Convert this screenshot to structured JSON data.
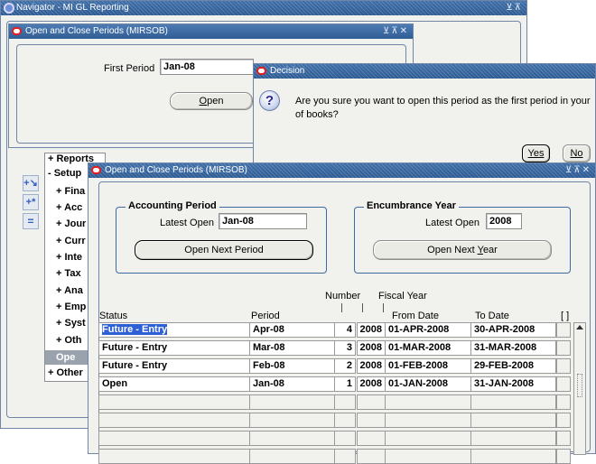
{
  "navigator": {
    "title": "Navigator - MI GL Reporting",
    "controls": "⊻⊼"
  },
  "first_window": {
    "title": "Open and Close Periods (MIRSOB)",
    "controls": "⊻⊼✕",
    "first_period_label": "First Period",
    "first_period_value": "Jan-08",
    "open_button": "Open",
    "open_button_mnemonic": "O"
  },
  "tree": {
    "items": [
      {
        "label": "+ Reports",
        "level": 0
      },
      {
        "label": "- Setup",
        "level": 0
      },
      {
        "label": "+ Fina",
        "level": 1
      },
      {
        "label": "+ Acc",
        "level": 1
      },
      {
        "label": "+ Jour",
        "level": 1
      },
      {
        "label": "+ Curr",
        "level": 1
      },
      {
        "label": "+ Inte",
        "level": 1
      },
      {
        "label": "+ Tax",
        "level": 1
      },
      {
        "label": "+ Ana",
        "level": 1
      },
      {
        "label": "+ Emp",
        "level": 1
      },
      {
        "label": "+ Syst",
        "level": 1
      },
      {
        "label": "+ Oth",
        "level": 1
      },
      {
        "label": "Ope",
        "level": 1,
        "selected": true
      },
      {
        "label": "+ Other",
        "level": 0
      }
    ]
  },
  "decision": {
    "title": "Decision",
    "message_line1": "Are you sure you want to open this period as the first period in your se",
    "message_line2": "of books?",
    "yes": "Yes",
    "no": "No"
  },
  "main": {
    "title": "Open and Close Periods (MIRSOB)",
    "controls": "⊻⊼✕",
    "accounting_group": "Accounting Period",
    "latest_open_label": "Latest Open",
    "latest_open_value": "Jan-08",
    "open_next_period": "Open Next Period",
    "encumbrance_group": "Encumbrance Year",
    "enc_latest_open_label": "Latest Open",
    "enc_latest_open_value": "2008",
    "open_next_year": "Open Next Year",
    "headers": {
      "number": "Number",
      "fiscal_year": "Fiscal Year",
      "status": "Status",
      "period": "Period",
      "from_date": "From Date",
      "to_date": "To Date",
      "flex": "[ ]"
    },
    "rows": [
      {
        "status": "Future - Entry",
        "period": "Apr-08",
        "number": "4",
        "year": "2008",
        "from": "01-APR-2008",
        "to": "30-APR-2008"
      },
      {
        "status": "Future - Entry",
        "period": "Mar-08",
        "number": "3",
        "year": "2008",
        "from": "01-MAR-2008",
        "to": "31-MAR-2008"
      },
      {
        "status": "Future - Entry",
        "period": "Feb-08",
        "number": "2",
        "year": "2008",
        "from": "01-FEB-2008",
        "to": "29-FEB-2008"
      },
      {
        "status": "Open",
        "period": "Jan-08",
        "number": "1",
        "year": "2008",
        "from": "01-JAN-2008",
        "to": "31-JAN-2008"
      }
    ]
  }
}
